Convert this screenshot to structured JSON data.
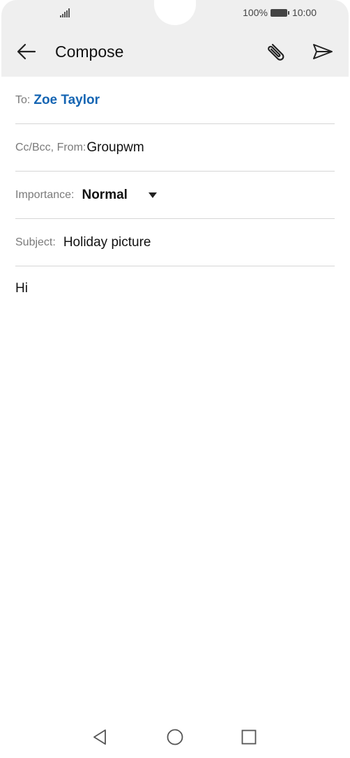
{
  "status_bar": {
    "battery_percent": "100%",
    "time": "10:00"
  },
  "app_bar": {
    "title": "Compose",
    "back_icon": "arrow-left-icon",
    "attach_icon": "paperclip-icon",
    "send_icon": "send-icon"
  },
  "form": {
    "to": {
      "label": "To:",
      "value": "Zoe Taylor"
    },
    "from": {
      "label": "Cc/Bcc, From:",
      "value": "Groupwm"
    },
    "importance": {
      "label": "Importance:",
      "value": "Normal"
    },
    "subject": {
      "label": "Subject:",
      "value": "Holiday picture"
    }
  },
  "body": {
    "text": "Hi"
  },
  "navigation": {
    "back_icon": "triangle-back-icon",
    "home_icon": "circle-home-icon",
    "recents_icon": "square-recents-icon"
  },
  "colors": {
    "accent": "#1565b3",
    "header_bg": "#efefef",
    "divider": "#d6d6d6"
  }
}
